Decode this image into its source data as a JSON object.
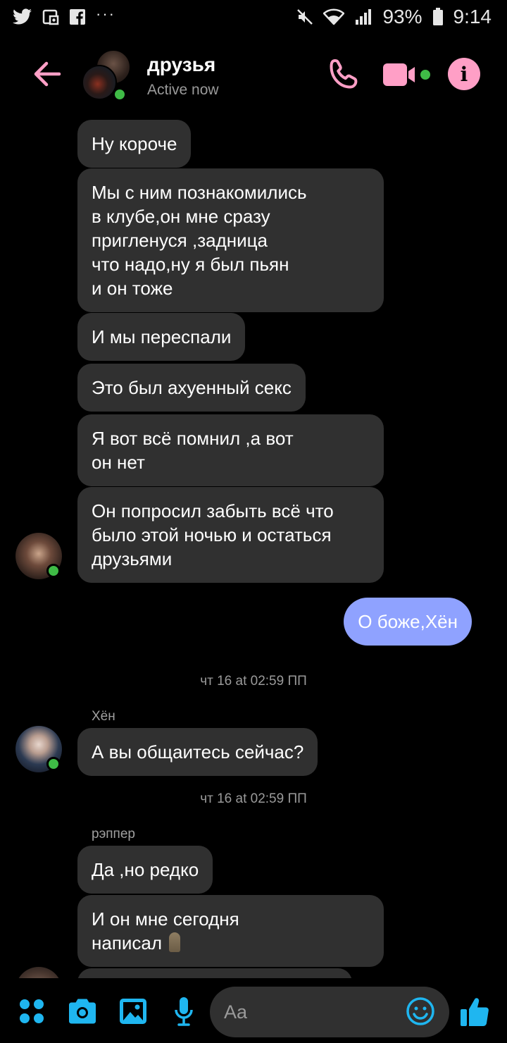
{
  "status_bar": {
    "battery": "93%",
    "time": "9:14",
    "left_icons": [
      "twitter-icon",
      "screenshot-icon",
      "facebook-icon",
      "more-icon"
    ],
    "right_icons": [
      "mute-icon",
      "wifi-icon",
      "signal-icon",
      "battery-icon"
    ]
  },
  "header": {
    "title": "друзья",
    "status": "Active now"
  },
  "messages": [
    {
      "text": "Ну короче"
    },
    {
      "text": "Мы с ним познакомились\nв клубе,он мне сразу\nпригленуся ,задница\nчто надо,ну я был пьян\nи он тоже"
    },
    {
      "text": "И мы переспали"
    },
    {
      "text": "Это был ахуенный секс"
    },
    {
      "text": "Я вот всё помнил ,а вот\nон нет"
    },
    {
      "text": "Он попросил забыть всё что\nбыло этой ночью и остаться\nдрузьями"
    },
    {
      "text": "О боже,Хён"
    },
    {
      "text": "А вы общаитесь сейчас?"
    },
    {
      "text": "Да ,но редко"
    },
    {
      "text": "И он мне сегодня\nнаписал"
    }
  ],
  "timestamps": [
    "чт 16 at 02:59 ПП",
    "чт 16 at 02:59 ПП"
  ],
  "senders": [
    "Хён",
    "рэппер"
  ],
  "composer": {
    "placeholder": "Aa"
  },
  "colors": {
    "accent": "#ff9fc6",
    "outgoing_bubble": "#8fa2ff",
    "incoming_bubble": "#303030",
    "online": "#3fbb46",
    "composer_icons": "#1fb6f0"
  }
}
